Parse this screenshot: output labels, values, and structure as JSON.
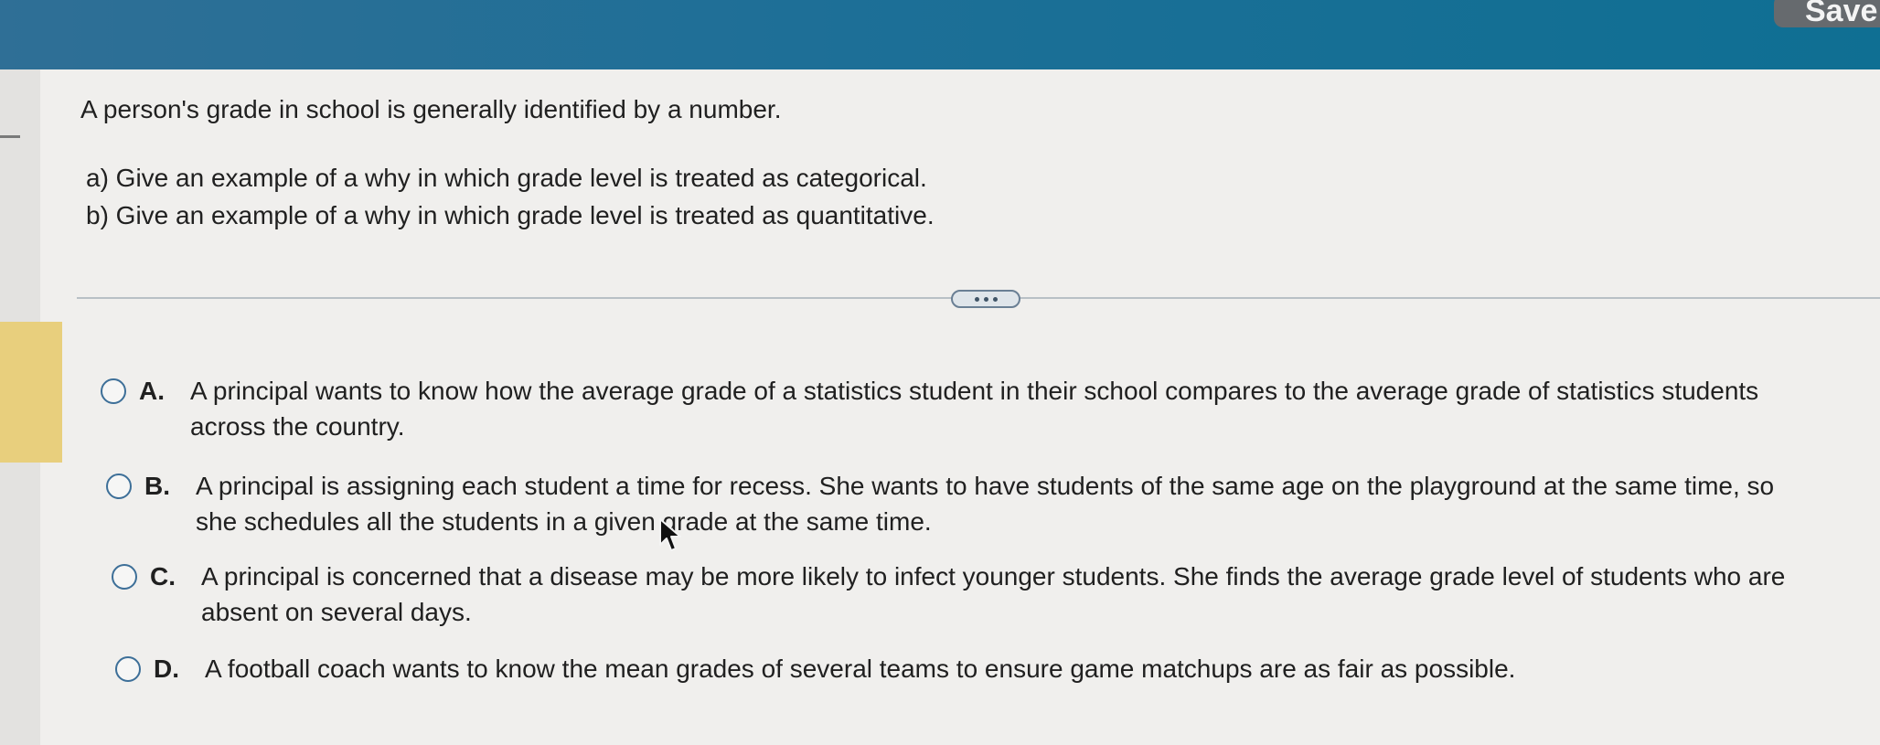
{
  "header": {
    "save_label": "Save"
  },
  "question": {
    "prompt": "A person's grade in school is generally identified by a number.",
    "part_a": "a) Give an example of a why in which grade level is treated as categorical.",
    "part_b": "b) Give an example of a why in which grade level is treated as quantitative."
  },
  "options": [
    {
      "letter": "A.",
      "text": "A principal wants to know how the average grade of a statistics student in their school compares to the average grade of statistics students across the country."
    },
    {
      "letter": "B.",
      "text": "A principal is assigning each student a time for recess. She wants to have students of the same age on the playground at the same time, so she schedules all the students in a given grade at the same time."
    },
    {
      "letter": "C.",
      "text": "A principal is concerned that a disease may be more likely to infect younger students. She finds the average grade level of students who are absent on several days."
    },
    {
      "letter": "D.",
      "text": "A football coach wants to know the mean grades of several teams to ensure game matchups are as fair as possible."
    }
  ],
  "icons": {
    "more": "more-options-icon",
    "cursor": "mouse-pointer-icon",
    "radio": "radio-button-icon"
  },
  "colors": {
    "header": "#1d6f97",
    "radio_border": "#3d6f98",
    "highlight": "#e8cf7d"
  }
}
